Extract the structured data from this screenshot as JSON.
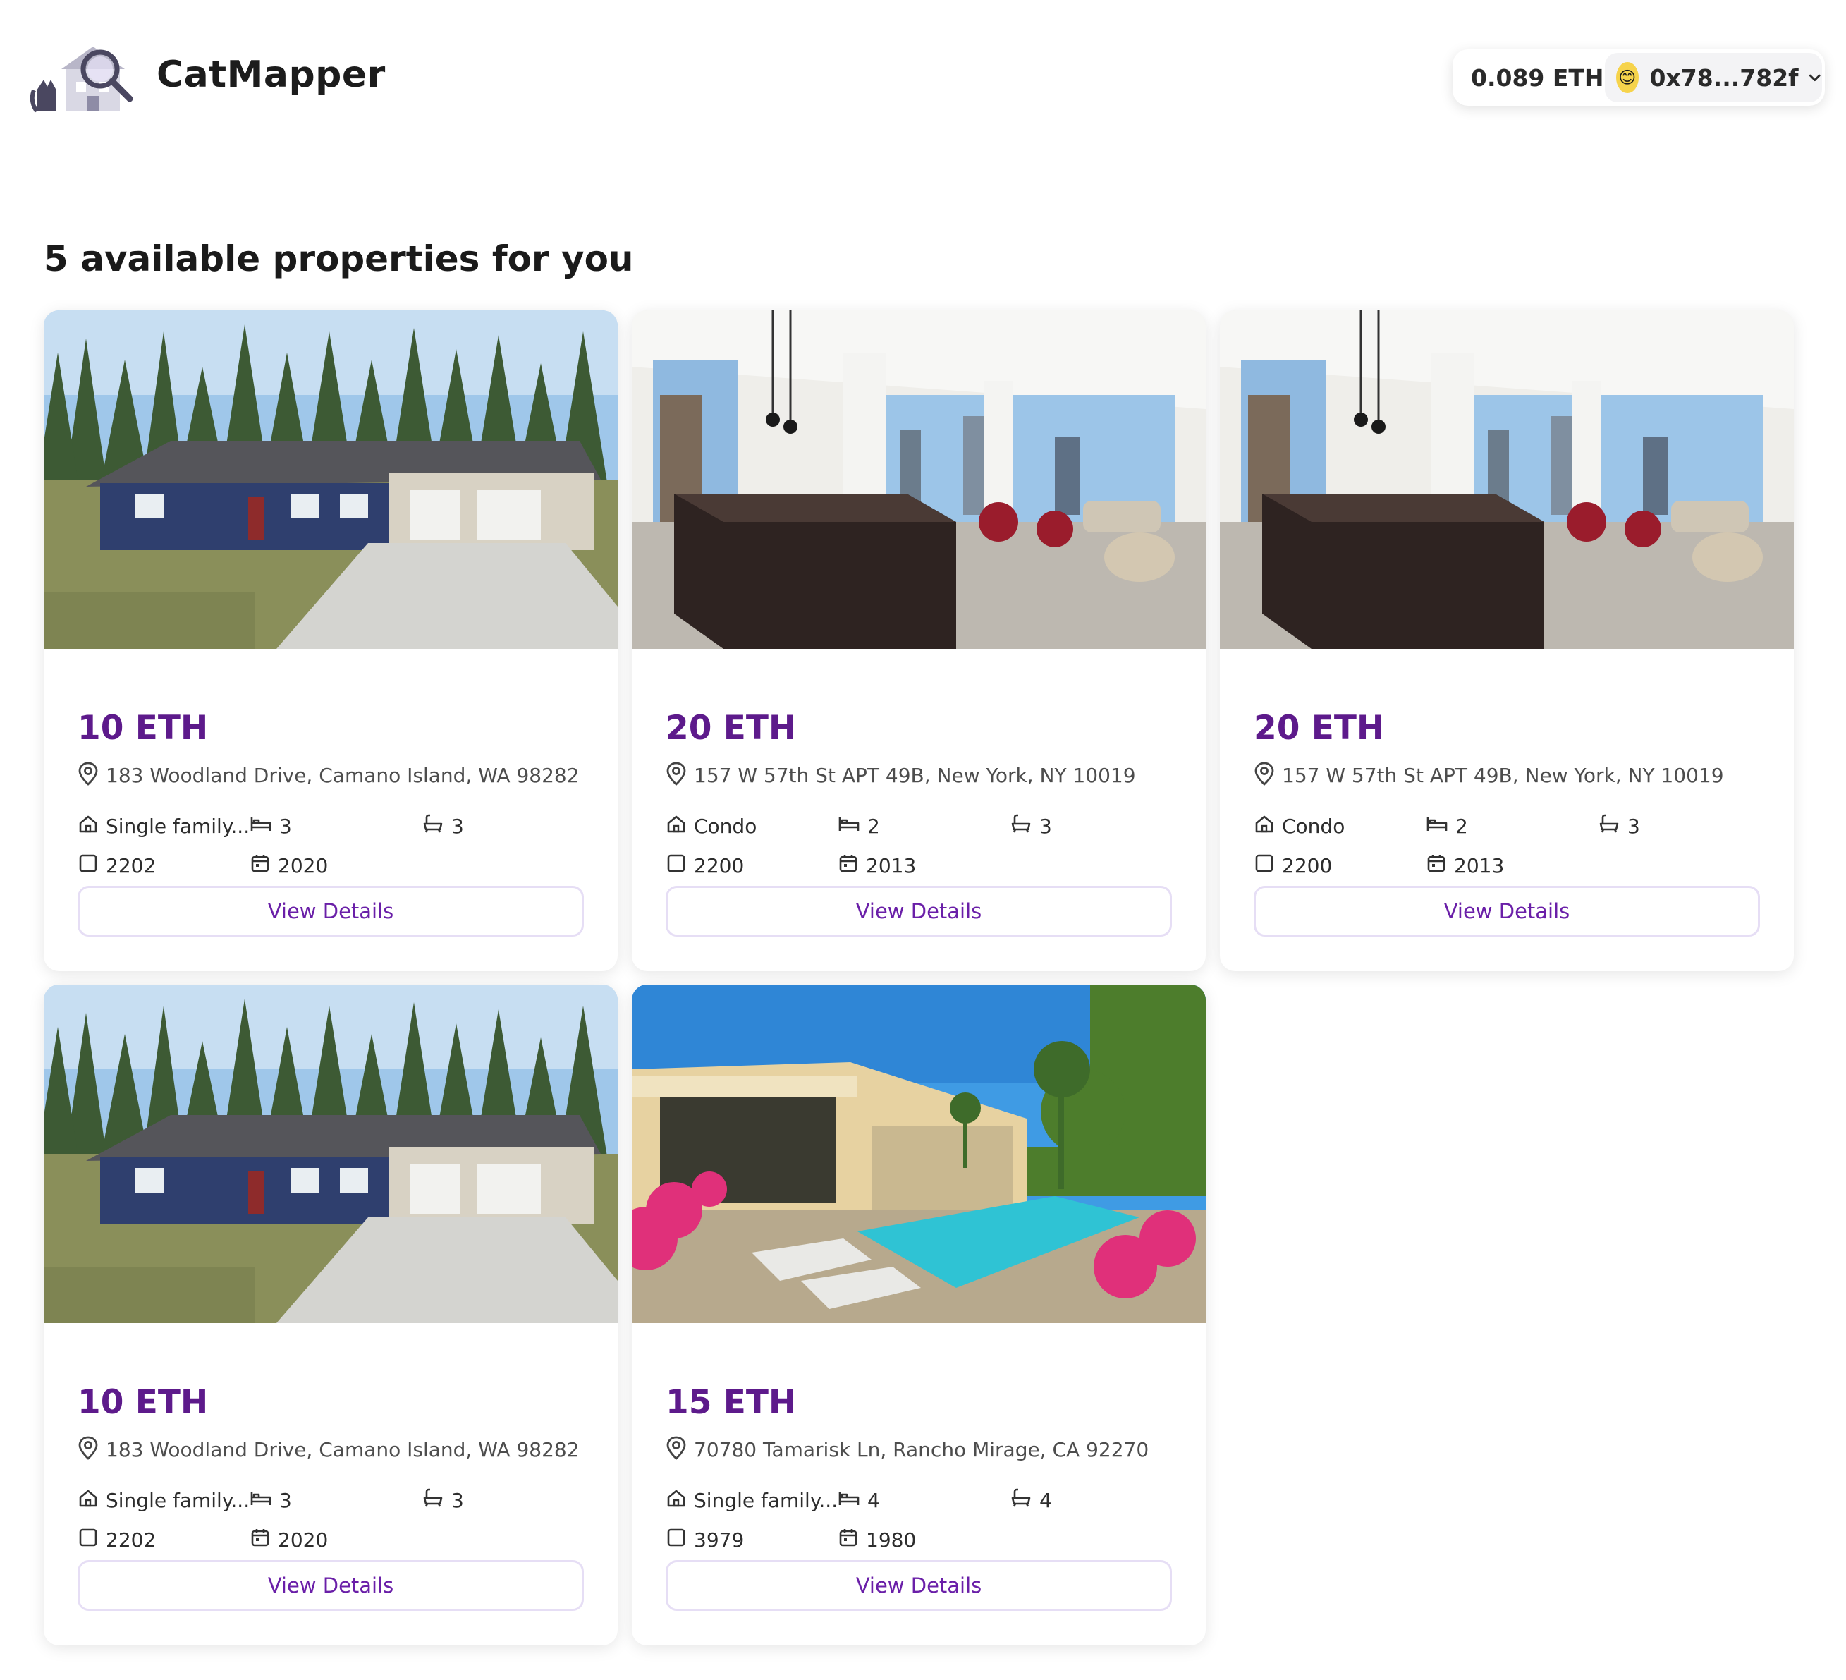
{
  "app": {
    "brand": "CatMapper"
  },
  "wallet": {
    "balance": "0.089 ETH",
    "address": "0x78...782f",
    "avatar_icon": "smiley-face-icon"
  },
  "main": {
    "heading": "5 available properties for you"
  },
  "properties": [
    {
      "image": "suburban-house-photo",
      "price": "10 ETH",
      "address": "183 Woodland Drive, Camano Island, WA 98282",
      "type": "Single family...",
      "beds": "3",
      "baths": "3",
      "area": "2202",
      "year": "2020",
      "button": "View Details"
    },
    {
      "image": "condo-interior-photo",
      "price": "20 ETH",
      "address": "157 W 57th St APT 49B, New York, NY 10019",
      "type": "Condo",
      "beds": "2",
      "baths": "3",
      "area": "2200",
      "year": "2013",
      "button": "View Details"
    },
    {
      "image": "condo-interior-photo",
      "price": "20 ETH",
      "address": "157 W 57th St APT 49B, New York, NY 10019",
      "type": "Condo",
      "beds": "2",
      "baths": "3",
      "area": "2200",
      "year": "2013",
      "button": "View Details"
    },
    {
      "image": "suburban-house-photo",
      "price": "10 ETH",
      "address": "183 Woodland Drive, Camano Island, WA 98282",
      "type": "Single family...",
      "beds": "3",
      "baths": "3",
      "area": "2202",
      "year": "2020",
      "button": "View Details"
    },
    {
      "image": "pool-villa-photo",
      "price": "15 ETH",
      "address": "70780 Tamarisk Ln, Rancho Mirage, CA 92270",
      "type": "Single family...",
      "beds": "4",
      "baths": "4",
      "area": "3979",
      "year": "1980",
      "button": "View Details"
    }
  ],
  "colors": {
    "price": "#5d1a8b",
    "button_text": "#6a1fa8",
    "button_border": "#e6def5"
  }
}
